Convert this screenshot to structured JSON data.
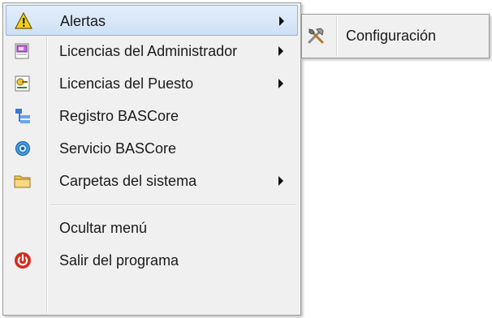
{
  "menu": {
    "items": [
      {
        "label": "Alertas",
        "icon": "warning-icon",
        "has_submenu": true
      },
      {
        "label": "Licencias del Administrador",
        "icon": "license-admin-icon",
        "has_submenu": true
      },
      {
        "label": "Licencias del Puesto",
        "icon": "license-workstation-icon",
        "has_submenu": true
      },
      {
        "label": "Registro BASCore",
        "icon": "registry-icon",
        "has_submenu": false
      },
      {
        "label": "Servicio BASCore",
        "icon": "service-gear-icon",
        "has_submenu": false
      },
      {
        "label": "Carpetas del sistema",
        "icon": "folder-icon",
        "has_submenu": true
      },
      {
        "label": "Ocultar menú",
        "icon": "",
        "has_submenu": false
      },
      {
        "label": "Salir del programa",
        "icon": "power-icon",
        "has_submenu": false
      }
    ]
  },
  "submenu": {
    "items": [
      {
        "label": "Configuración",
        "icon": "tools-icon"
      }
    ]
  },
  "colors": {
    "highlight": "#cfe0f6",
    "highlight_border": "#8db2e3",
    "menu_background": "#f0f0f0",
    "exit_icon": "#d62b1e"
  }
}
